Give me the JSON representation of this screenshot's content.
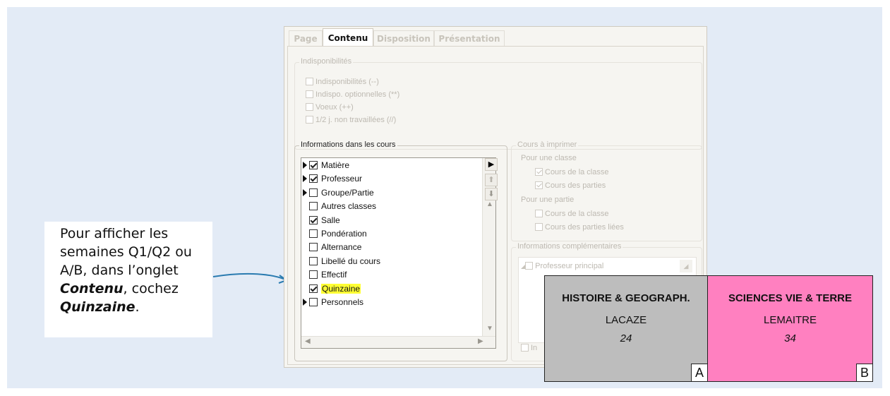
{
  "callout": {
    "line1": "Pour afficher les",
    "line2": "semaines Q1/Q2 ou",
    "line3": "A/B, dans l’onglet",
    "tab_name": "Contenu",
    "line4_tail": ", cochez",
    "option_name": "Quinzaine",
    "period": "."
  },
  "tabs": [
    "Page",
    "Contenu",
    "Disposition",
    "Présentation"
  ],
  "indispo": {
    "legend": "Indisponibilités",
    "options": [
      "Indisponibilités (--)",
      "Indispo. optionnelles (**)",
      "Voeux (++)",
      "1/2 j. non travaillées (//)"
    ]
  },
  "infos": {
    "legend": "Informations dans les cours",
    "items": [
      {
        "label": "Matière",
        "checked": true,
        "expand": true
      },
      {
        "label": "Professeur",
        "checked": true,
        "expand": true
      },
      {
        "label": "Groupe/Partie",
        "checked": false,
        "expand": true
      },
      {
        "label": "Autres classes",
        "checked": false,
        "expand": false
      },
      {
        "label": "Salle",
        "checked": true,
        "expand": false
      },
      {
        "label": "Pondération",
        "checked": false,
        "expand": false
      },
      {
        "label": "Alternance",
        "checked": false,
        "expand": false
      },
      {
        "label": "Libellé du cours",
        "checked": false,
        "expand": false
      },
      {
        "label": "Effectif",
        "checked": false,
        "expand": false
      },
      {
        "label": "Quinzaine",
        "checked": true,
        "expand": false,
        "highlight": true
      },
      {
        "label": "Personnels",
        "checked": false,
        "expand": true
      }
    ]
  },
  "cours": {
    "legend": "Cours à imprimer",
    "classe_title": "Pour une classe",
    "classe_opt1": "Cours de la classe",
    "classe_opt2": "Cours des parties",
    "partie_title": "Pour une partie",
    "partie_opt1": "Cours de la classe",
    "partie_opt2": "Cours des parties liées"
  },
  "complements": {
    "legend": "Informations complémentaires",
    "item1": "Professeur principal",
    "partial": "In"
  },
  "cards": [
    {
      "subject": "HISTOIRE & GEOGRAPH.",
      "teacher": "LACAZE",
      "room": "24",
      "week": "A",
      "color": "#bdbdbd"
    },
    {
      "subject": "SCIENCES VIE & TERRE",
      "teacher": "LEMAITRE",
      "room": "34",
      "week": "B",
      "color": "#ff80c0"
    }
  ],
  "colors": {
    "background_panel": "#e3ebf6",
    "highlight": "#ffff33",
    "arrow": "#2a7bb0"
  }
}
